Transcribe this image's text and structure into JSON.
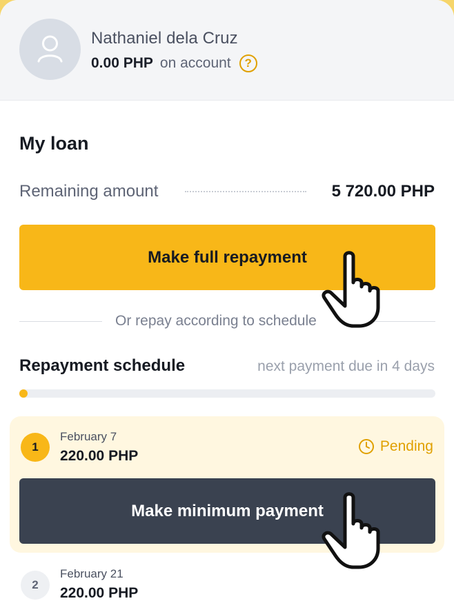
{
  "profile": {
    "name": "Nathaniel dela Cruz",
    "balance_amount": "0.00 PHP",
    "balance_suffix": "on account",
    "help_icon": "?"
  },
  "loan": {
    "title": "My loan",
    "remaining_label": "Remaining amount",
    "remaining_value": "5 720.00 PHP",
    "full_repayment_label": "Make full repayment",
    "or_text": "Or repay according to schedule"
  },
  "schedule": {
    "title": "Repayment schedule",
    "note": "next payment due in 4 days",
    "progress_fraction": 0.02,
    "payments": [
      {
        "number": "1",
        "date": "February 7",
        "amount": "220.00 PHP",
        "status": "Pending",
        "button_label": "Make minimum payment"
      },
      {
        "number": "2",
        "date": "February 21",
        "amount": "220.00 PHP"
      }
    ]
  },
  "colors": {
    "accent": "#f8b718",
    "dark_button": "#3a4250",
    "pending": "#e0a000",
    "card_highlight": "#fff7e0"
  },
  "icons": [
    "user-avatar-icon",
    "help-icon",
    "clock-icon",
    "pointer-hand-icon"
  ]
}
